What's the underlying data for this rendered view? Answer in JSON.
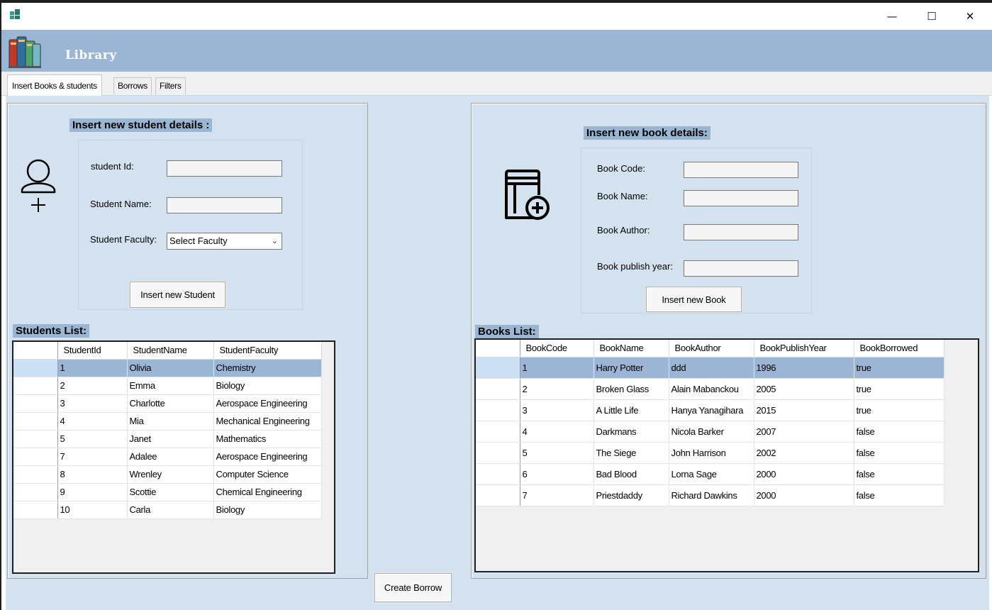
{
  "window": {
    "title": ""
  },
  "header": {
    "title": "Library"
  },
  "tabs": [
    {
      "label": "Insert Books & students",
      "active": true
    },
    {
      "label": "Borrows",
      "active": false
    },
    {
      "label": "Filters",
      "active": false
    }
  ],
  "student_form": {
    "title": "Insert new student details :",
    "id_label": "student Id:",
    "name_label": "Student Name:",
    "faculty_label": "Student Faculty:",
    "faculty_selected": "Select Faculty",
    "id_value": "",
    "name_value": "",
    "submit_label": "Insert new Student"
  },
  "book_form": {
    "title": "Insert  new book details:",
    "code_label": "Book Code:",
    "name_label": "Book Name:",
    "author_label": "Book Author:",
    "year_label": "Book publish year:",
    "submit_label": "Insert new Book"
  },
  "students_list": {
    "title": "Students List:",
    "columns": [
      "StudentId",
      "StudentName",
      "StudentFaculty"
    ],
    "rows": [
      [
        "1",
        "Olivia",
        "Chemistry"
      ],
      [
        "2",
        "Emma",
        "Biology"
      ],
      [
        "3",
        "Charlotte",
        "Aerospace Engineering"
      ],
      [
        "4",
        "Mia",
        "Mechanical Engineering"
      ],
      [
        "5",
        "Janet",
        "Mathematics"
      ],
      [
        "7",
        "Adalee",
        "Aerospace Engineering"
      ],
      [
        "8",
        "Wrenley",
        "Computer Science"
      ],
      [
        "9",
        "Scottie",
        "Chemical Engineering"
      ],
      [
        "10",
        "Carla",
        "Biology"
      ]
    ],
    "selected_row": 0
  },
  "books_list": {
    "title": "Books List:",
    "columns": [
      "BookCode",
      "BookName",
      "BookAuthor",
      "BookPublishYear",
      "BookBorrowed"
    ],
    "rows": [
      [
        "1",
        "Harry Potter",
        "ddd",
        "1996",
        "true"
      ],
      [
        "2",
        "Broken Glass",
        "Alain Mabanckou",
        "2005",
        "true"
      ],
      [
        "3",
        "A Little Life",
        "Hanya Yanagihara",
        "2015",
        "true"
      ],
      [
        "4",
        "Darkmans",
        "Nicola Barker",
        "2007",
        "false"
      ],
      [
        "5",
        "The Siege",
        "John Harrison",
        "2002",
        "false"
      ],
      [
        "6",
        "Bad Blood",
        "Lorna Sage",
        "2000",
        "false"
      ],
      [
        "7",
        "Priestdaddy",
        "Richard Dawkins",
        "2000",
        "false"
      ]
    ],
    "selected_row": 0
  },
  "create_borrow_label": "Create Borrow",
  "icons": {
    "app": "app-window-icon",
    "logo": "books-logo-icon",
    "student": "add-user-icon",
    "book": "add-book-icon"
  },
  "colors": {
    "header_bg": "#9ab6d3",
    "content_bg": "#d4e1ef",
    "selected_row": "#9db5d4"
  }
}
